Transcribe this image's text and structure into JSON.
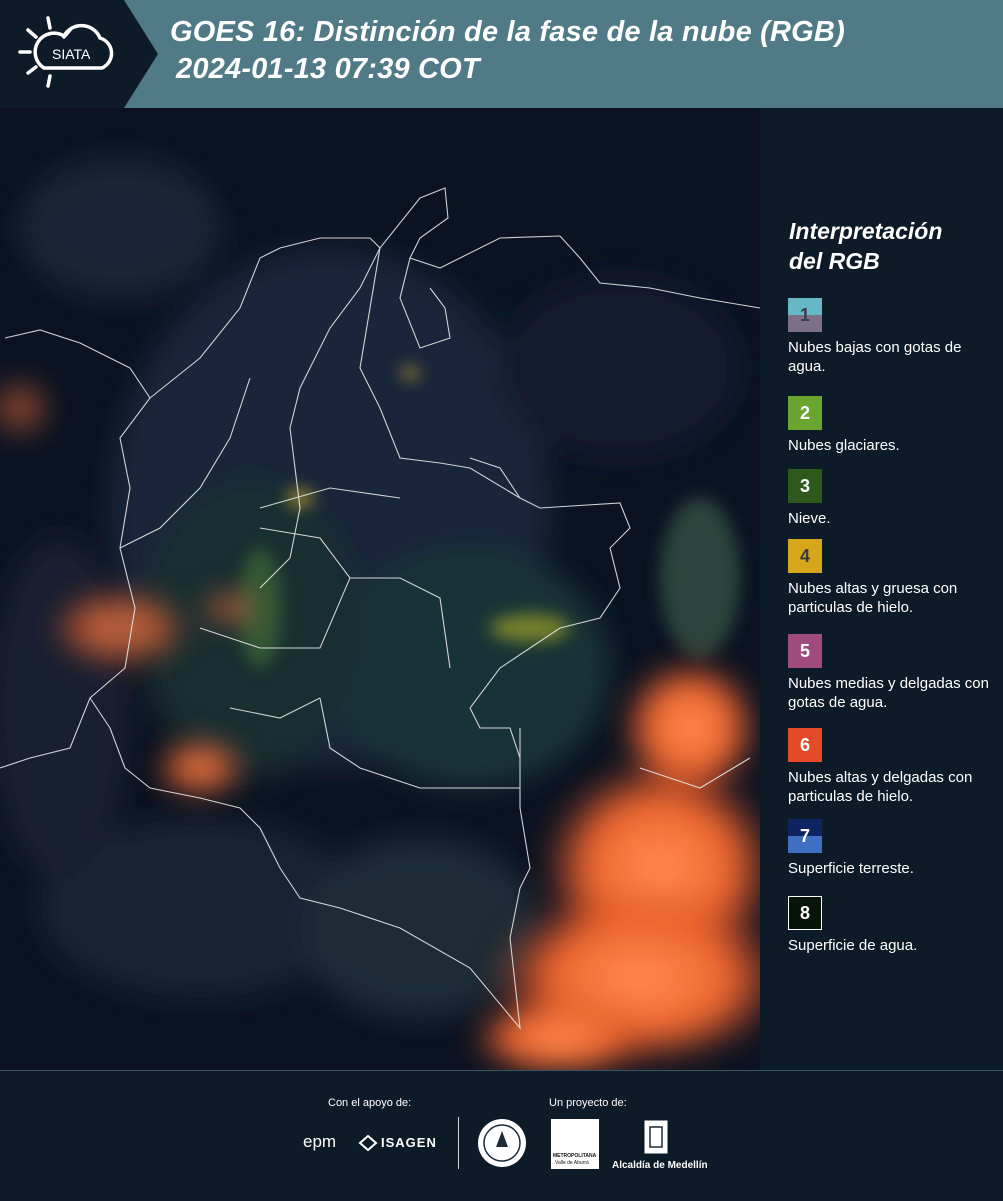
{
  "header": {
    "logo_text": "SIATA",
    "title_line1": "GOES 16: Distinción de la fase de la nube (RGB)",
    "title_line2": "2024-01-13 07:39 COT"
  },
  "legend": {
    "title_line1": "Interpretación",
    "title_line2": "del RGB",
    "items": [
      {
        "number": "1",
        "label": "Nubes bajas con gotas de agua.",
        "color_top": "#66b8c6",
        "color_bottom": "#7e6f89",
        "text_color": "#3b3b4a"
      },
      {
        "number": "2",
        "label": "Nubes glaciares.",
        "color": "#6aa530",
        "text_color": "#ffffff"
      },
      {
        "number": "3",
        "label": "Nieve.",
        "color": "#2d5a1c",
        "text_color": "#ffffff"
      },
      {
        "number": "4",
        "label": "Nubes altas y gruesa con particulas de hielo.",
        "color": "#d5a51a",
        "text_color": "#3b3b3b"
      },
      {
        "number": "5",
        "label": "Nubes medias y delgadas con gotas de agua.",
        "color": "#a04b7d",
        "text_color": "#ffffff"
      },
      {
        "number": "6",
        "label": "Nubes altas y delgadas con particulas de hielo.",
        "color": "#e34a25",
        "text_color": "#ffffff"
      },
      {
        "number": "7",
        "label": "Superficie terreste.",
        "color_top": "#0e2462",
        "color_bottom": "#3f6fc2",
        "text_color": "#ffffff"
      },
      {
        "number": "8",
        "label": "Superficie de agua.",
        "color": "#07140a",
        "text_color": "#ffffff",
        "border": "#ffffff"
      }
    ]
  },
  "footer": {
    "support_label": "Con el apoyo de:",
    "project_label": "Un proyecto de:",
    "sponsor_1": "epm",
    "sponsor_2": "ISAGEN",
    "partner_1": "Área Metropolitana Valle de Aburrá",
    "partner_1_line1": "METROPOLITANA",
    "partner_1_line2": "Valle de Aburrá",
    "partner_2": "Alcaldía de Medellín"
  }
}
